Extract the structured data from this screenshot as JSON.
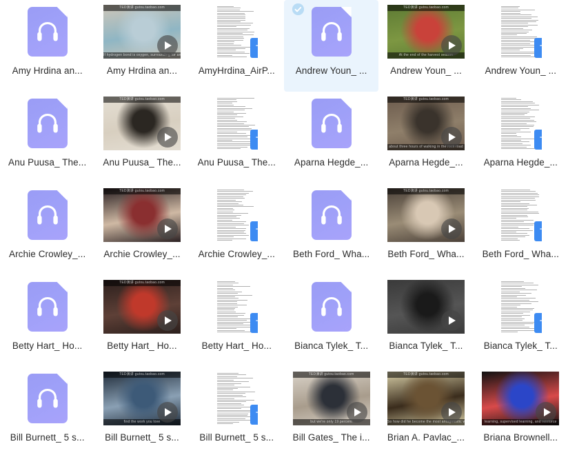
{
  "view": {
    "name": "file-grid-view",
    "columns": 6,
    "rows": 5,
    "selected_index": 3,
    "accent_selected_bg": "#eaf4fd",
    "audio_icon_color": "#9fa1f7",
    "text_badge_color": "#3d8bf2",
    "check_badge_color": "#b9dcf5"
  },
  "icons": {
    "audio": "headphones-audio-file-icon",
    "video": "video-thumbnail",
    "text": "text-document-icon",
    "play": "play-icon",
    "check": "check-circle-icon"
  },
  "files": [
    {
      "label": "Amy Hrdina an...",
      "type": "audio",
      "selected": false
    },
    {
      "label": "Amy Hrdina an...",
      "type": "video",
      "selected": false,
      "band_top": "TED演讲 gutou.taobao.com",
      "band_bottom": "If hydrogen bond is oxygen, surrounding for any",
      "colors": [
        "#cfc6b8",
        "#b9cdd6",
        "#8fb6c4"
      ]
    },
    {
      "label": "AmyHrdina_AirP...",
      "type": "text",
      "selected": false
    },
    {
      "label": "Andrew Youn_ ...",
      "type": "audio",
      "selected": true
    },
    {
      "label": "Andrew Youn_ ...",
      "type": "video",
      "selected": false,
      "band_top": "TED演讲 gutou.taobao.com",
      "band_bottom": "At the end of the harvest season",
      "colors": [
        "#5d7a34",
        "#c9423a",
        "#7d9742"
      ]
    },
    {
      "label": "Andrew Youn_ ...",
      "type": "text",
      "selected": false
    },
    {
      "label": "Anu Puusa_ The...",
      "type": "audio",
      "selected": false
    },
    {
      "label": "Anu Puusa_ The...",
      "type": "video",
      "selected": false,
      "band_top": "TED演讲 gutou.taobao.com",
      "band_bottom": "",
      "colors": [
        "#e4ded3",
        "#2b2722",
        "#d8cfc0"
      ]
    },
    {
      "label": "Anu Puusa_ The...",
      "type": "text",
      "selected": false
    },
    {
      "label": "Aparna Hegde_...",
      "type": "audio",
      "selected": false
    },
    {
      "label": "Aparna Hegde_...",
      "type": "video",
      "selected": false,
      "band_top": "TED演讲 gutou.taobao.com",
      "band_bottom": "about three hours of walking in the rock road",
      "colors": [
        "#6b5a4c",
        "#3a332c",
        "#8f7f6a"
      ]
    },
    {
      "label": "Aparna Hegde_...",
      "type": "text",
      "selected": false
    },
    {
      "label": "Archie Crowley_...",
      "type": "audio",
      "selected": false
    },
    {
      "label": "Archie Crowley_...",
      "type": "video",
      "selected": false,
      "band_top": "TED演讲 gutou.taobao.com",
      "band_bottom": "",
      "colors": [
        "#2a2022",
        "#8a2f30",
        "#cfb9a4"
      ]
    },
    {
      "label": "Archie Crowley_...",
      "type": "text",
      "selected": false
    },
    {
      "label": "Beth Ford_ Wha...",
      "type": "audio",
      "selected": false
    },
    {
      "label": "Beth Ford_ Wha...",
      "type": "video",
      "selected": false,
      "band_top": "TED演讲 gutou.taobao.com",
      "band_bottom": "",
      "colors": [
        "#4a4038",
        "#d8c8b4",
        "#9a8c76"
      ]
    },
    {
      "label": "Beth Ford_ Wha...",
      "type": "text",
      "selected": false
    },
    {
      "label": "Betty Hart_ Ho...",
      "type": "audio",
      "selected": false
    },
    {
      "label": "Betty Hart_ Ho...",
      "type": "video",
      "selected": false,
      "band_top": "TED演讲 gutou.taobao.com",
      "band_bottom": "",
      "colors": [
        "#2b1f1c",
        "#c0392b",
        "#5e4037"
      ]
    },
    {
      "label": "Betty Hart_ Ho...",
      "type": "text",
      "selected": false
    },
    {
      "label": "Bianca Tylek_ T...",
      "type": "audio",
      "selected": false
    },
    {
      "label": "Bianca Tylek_ T...",
      "type": "video",
      "selected": false,
      "band_top": "",
      "band_bottom": "",
      "colors": [
        "#3a3a3a",
        "#1a1a1a",
        "#555555"
      ]
    },
    {
      "label": "Bianca Tylek_ T...",
      "type": "text",
      "selected": false
    },
    {
      "label": "Bill Burnett_ 5 s...",
      "type": "audio",
      "selected": false
    },
    {
      "label": "Bill Burnett_ 5 s...",
      "type": "video",
      "selected": false,
      "band_top": "TED演讲 gutou.taobao.com",
      "band_bottom": "find the work you love",
      "colors": [
        "#1e2a38",
        "#3d5a78",
        "#8aa0b4"
      ]
    },
    {
      "label": "Bill Burnett_ 5 s...",
      "type": "text",
      "selected": false
    },
    {
      "label": "Bill Gates_ The i...",
      "type": "video",
      "selected": false,
      "band_top": "TED演讲 gutou.taobao.com",
      "band_bottom": "but we're only 19 percent",
      "colors": [
        "#d9d2c8",
        "#2c3038",
        "#a89c8c"
      ]
    },
    {
      "label": "Brian A. Pavlac_...",
      "type": "video",
      "selected": false,
      "band_top": "TED演讲 gutou.taobao.com",
      "band_bottom": "So how did he become the most antagonistic with so many different themes",
      "colors": [
        "#d8cfa8",
        "#6b5334",
        "#3a2c1c"
      ]
    },
    {
      "label": "Briana Brownell...",
      "type": "video",
      "selected": false,
      "band_top": "",
      "band_bottom": "learning, supervised  learning, and reinforce",
      "colors": [
        "#111111",
        "#2b46c8",
        "#d84a4a"
      ]
    }
  ]
}
